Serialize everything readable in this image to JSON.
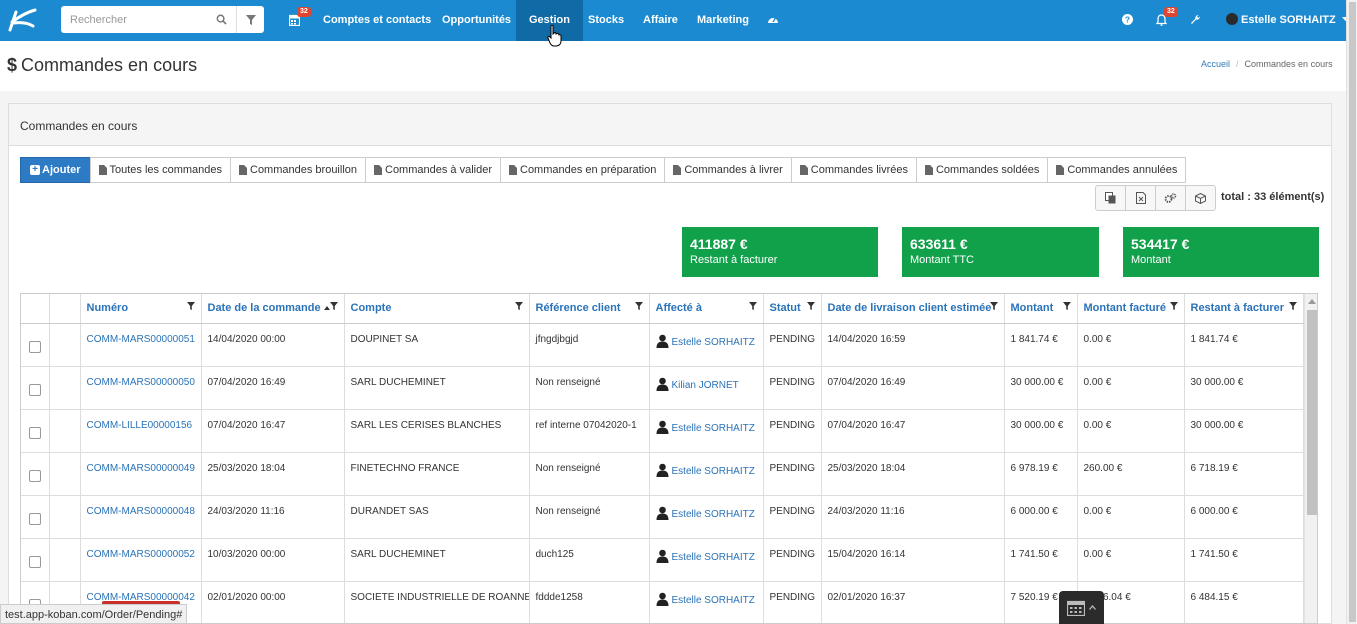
{
  "topbar": {
    "search_placeholder": "Rechercher",
    "calendar_badge": "32",
    "notif_badge": "32",
    "nav": [
      {
        "label": "Comptes et contacts"
      },
      {
        "label": "Opportunités"
      },
      {
        "label": "Gestion"
      },
      {
        "label": "Stocks"
      },
      {
        "label": "Affaire"
      },
      {
        "label": "Marketing"
      }
    ],
    "user_name": "Estelle SORHAITZ"
  },
  "page": {
    "title": "Commandes en cours",
    "breadcrumb_home": "Accueil",
    "breadcrumb_current": "Commandes en cours",
    "panel_title": "Commandes en cours"
  },
  "tabs": {
    "add": "Ajouter",
    "items": [
      "Toutes les commandes",
      "Commandes brouillon",
      "Commandes à valider",
      "Commandes en préparation",
      "Commandes à livrer",
      "Commandes livrées",
      "Commandes soldées",
      "Commandes annulées"
    ]
  },
  "total": "total : 33 élément(s)",
  "stats": [
    {
      "value": "411887 €",
      "label": "Restant à facturer"
    },
    {
      "value": "633611 €",
      "label": "Montant TTC"
    },
    {
      "value": "534417 €",
      "label": "Montant"
    }
  ],
  "table": {
    "headers": [
      "Numéro",
      "Date de la commande",
      "Compte",
      "Référence client",
      "Affecté à",
      "Statut",
      "Date de livraison client estimée",
      "Montant",
      "Montant facturé",
      "Restant à facturer"
    ],
    "rows": [
      [
        "COMM-MARS00000051",
        "14/04/2020 00:00",
        "DOUPINET SA",
        "jfngdjbgjd",
        "Estelle SORHAITZ",
        "PENDING",
        "14/04/2020 16:59",
        "1 841.74 €",
        "0.00 €",
        "1 841.74 €"
      ],
      [
        "COMM-MARS00000050",
        "07/04/2020 16:49",
        "SARL DUCHEMINET",
        "Non renseigné",
        "Kilian JORNET",
        "PENDING",
        "07/04/2020 16:49",
        "30 000.00 €",
        "0.00 €",
        "30 000.00 €"
      ],
      [
        "COMM-LILLE00000156",
        "07/04/2020 16:47",
        "SARL LES CERISES BLANCHES",
        "ref interne 07042020-1",
        "Estelle SORHAITZ",
        "PENDING",
        "07/04/2020 16:47",
        "30 000.00 €",
        "0.00 €",
        "30 000.00 €"
      ],
      [
        "COMM-MARS00000049",
        "25/03/2020 18:04",
        "FINETECHNO FRANCE",
        "Non renseigné",
        "Estelle SORHAITZ",
        "PENDING",
        "25/03/2020 18:04",
        "6 978.19 €",
        "260.00 €",
        "6 718.19 €"
      ],
      [
        "COMM-MARS00000048",
        "24/03/2020 11:16",
        "DURANDET SAS",
        "Non renseigné",
        "Estelle SORHAITZ",
        "PENDING",
        "24/03/2020 11:16",
        "6 000.00 €",
        "0.00 €",
        "6 000.00 €"
      ],
      [
        "COMM-MARS00000052",
        "10/03/2020 00:00",
        "SARL DUCHEMINET",
        "duch125",
        "Estelle SORHAITZ",
        "PENDING",
        "15/04/2020 16:14",
        "1 741.50 €",
        "0.00 €",
        "1 741.50 €"
      ],
      [
        "COMM-MARS00000042",
        "02/01/2020 00:00",
        "SOCIETE INDUSTRIELLE DE ROANNE",
        "fddde1258",
        "Estelle SORHAITZ",
        "PENDING",
        "02/01/2020 16:37",
        "7 520.19 €",
        "1 036.04 €",
        "6 484.15 €"
      ]
    ]
  },
  "statusbar": "test.app-koban.com/Order/Pending#",
  "colors": {
    "primary": "#1b8ad0",
    "active_nav": "#0f6aa6",
    "stat_green": "#12a14b",
    "add_button": "#2c7bc4"
  }
}
